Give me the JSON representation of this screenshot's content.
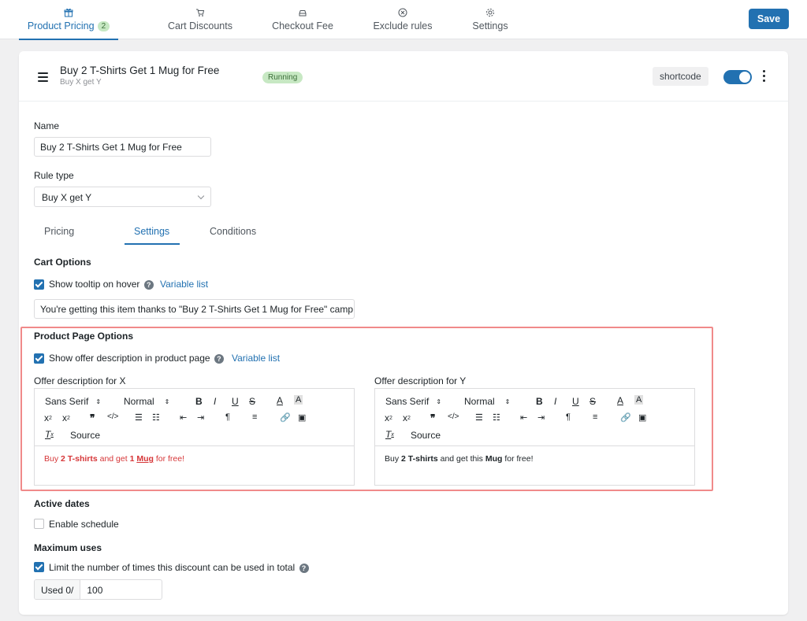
{
  "nav": {
    "tabs": [
      {
        "label": "Product Pricing",
        "badge": "2",
        "icon": "gift-icon"
      },
      {
        "label": "Cart Discounts",
        "icon": "cart-icon"
      },
      {
        "label": "Checkout Fee",
        "icon": "car-icon"
      },
      {
        "label": "Exclude rules",
        "icon": "x-circle-icon"
      },
      {
        "label": "Settings",
        "icon": "gear-icon"
      }
    ],
    "save_label": "Save"
  },
  "rule": {
    "title": "Buy 2 T-Shirts Get 1 Mug for Free",
    "subtitle": "Buy X get Y",
    "status": "Running",
    "shortcode_label": "shortcode",
    "enabled": true
  },
  "form": {
    "name_label": "Name",
    "name_value": "Buy 2 T-Shirts Get 1 Mug for Free",
    "rule_type_label": "Rule type",
    "rule_type_value": "Buy X get Y",
    "subtabs": [
      "Pricing",
      "Settings",
      "Conditions"
    ],
    "active_subtab": "Settings"
  },
  "cart_options": {
    "heading": "Cart Options",
    "tooltip_label": "Show tooltip on hover",
    "tooltip_checked": true,
    "variable_list": "Variable list",
    "tooltip_text": "You're getting this item thanks to \"Buy 2 T-Shirts Get 1 Mug for Free\" camp"
  },
  "product_page": {
    "heading": "Product Page Options",
    "offer_label": "Show offer description in product page",
    "offer_checked": true,
    "variable_list": "Variable list",
    "editor_x": {
      "label": "Offer description for X",
      "font": "Sans Serif",
      "size": "Normal",
      "source": "Source",
      "text": {
        "a": "Buy ",
        "b": "2 T-shirts",
        "c": " and get ",
        "d": "1",
        "e": " ",
        "f": "Mug",
        "g": " for free!"
      }
    },
    "editor_y": {
      "label": "Offer description for Y",
      "font": "Sans Serif",
      "size": "Normal",
      "source": "Source",
      "text": {
        "a": "Buy ",
        "b": "2 T-shirts",
        "c": " and get this ",
        "d": "Mug",
        "e": " for free!"
      }
    },
    "accent_color": "#d63638"
  },
  "active_dates": {
    "heading": "Active dates",
    "schedule_label": "Enable schedule",
    "schedule_checked": false
  },
  "max_uses": {
    "heading": "Maximum uses",
    "limit_label": "Limit the number of times this discount can be used in total",
    "limit_checked": true,
    "used_label": "Used 0/",
    "limit_value": "100"
  },
  "colors": {
    "primary": "#2271b1",
    "success_bg": "#c7e8c3",
    "highlight": "#f08a8a"
  }
}
